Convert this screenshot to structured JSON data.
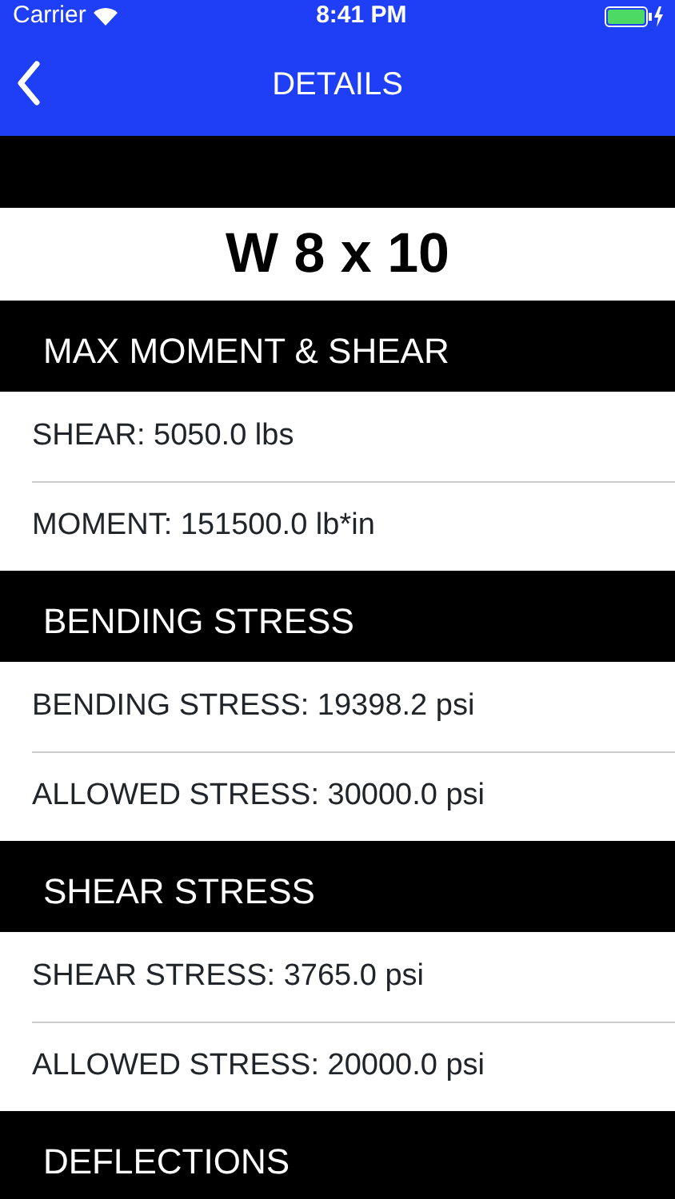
{
  "status_bar": {
    "carrier": "Carrier",
    "time": "8:41 PM"
  },
  "nav_bar": {
    "title": "DETAILS"
  },
  "beam_title": "W 8 x 10",
  "sections": [
    {
      "header": "MAX MOMENT & SHEAR",
      "rows": [
        "SHEAR: 5050.0 lbs",
        "MOMENT: 151500.0 lb*in"
      ]
    },
    {
      "header": "BENDING STRESS",
      "rows": [
        "BENDING STRESS: 19398.2 psi",
        "ALLOWED STRESS: 30000.0 psi"
      ]
    },
    {
      "header": "SHEAR STRESS",
      "rows": [
        "SHEAR STRESS: 3765.0 psi",
        "ALLOWED STRESS: 20000.0 psi"
      ]
    },
    {
      "header": "DEFLECTIONS"
    }
  ]
}
